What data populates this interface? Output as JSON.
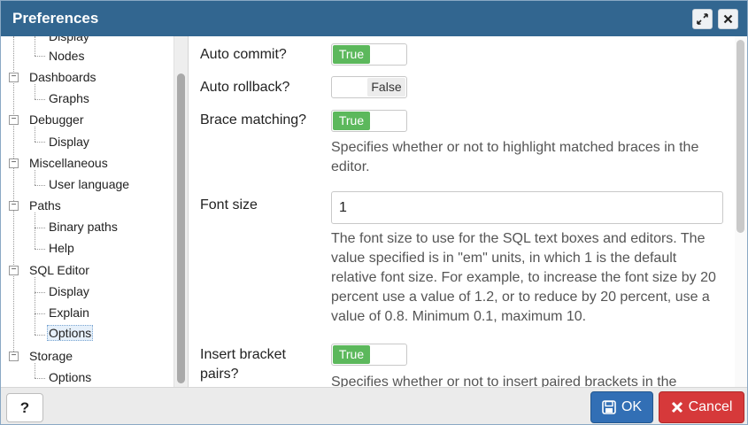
{
  "window": {
    "title": "Preferences",
    "expand_icon": "expand-icon",
    "close_icon": "close-icon"
  },
  "tree": {
    "items": [
      {
        "label": "Display"
      },
      {
        "label": "Nodes"
      },
      {
        "label": "Dashboards"
      },
      {
        "label": "Graphs"
      },
      {
        "label": "Debugger"
      },
      {
        "label": "Display"
      },
      {
        "label": "Miscellaneous"
      },
      {
        "label": "User language"
      },
      {
        "label": "Paths"
      },
      {
        "label": "Binary paths"
      },
      {
        "label": "Help"
      },
      {
        "label": "SQL Editor"
      },
      {
        "label": "Display"
      },
      {
        "label": "Explain"
      },
      {
        "label": "Options"
      },
      {
        "label": "Storage"
      },
      {
        "label": "Options"
      }
    ],
    "toggle_symbol": "−",
    "selected": "SQL Editor / Options"
  },
  "settings": {
    "auto_commit": {
      "label": "Auto commit?",
      "on_label": "True"
    },
    "auto_rollback": {
      "label": "Auto rollback?",
      "off_label": "False"
    },
    "brace_matching": {
      "label": "Brace matching?",
      "on_label": "True",
      "help": "Specifies whether or not to highlight matched braces in the editor."
    },
    "font_size": {
      "label": "Font size",
      "value": "1",
      "help": "The font size to use for the SQL text boxes and editors. The value specified is in \"em\" units, in which 1 is the default relative font size. For example, to increase the font size by 20 percent use a value of 1.2, or to reduce by 20 percent, use a value of 0.8. Minimum 0.1, maximum 10."
    },
    "insert_bracket_pairs": {
      "label": "Insert bracket pairs?",
      "on_label": "True",
      "help": "Specifies whether or not to insert paired brackets in the"
    }
  },
  "footer": {
    "help_label": "?",
    "ok_label": "OK",
    "cancel_label": "Cancel"
  },
  "colors": {
    "titlebar": "#326690",
    "toggle_on": "#5cb85c",
    "ok": "#326fb5",
    "cancel": "#d6393a"
  }
}
